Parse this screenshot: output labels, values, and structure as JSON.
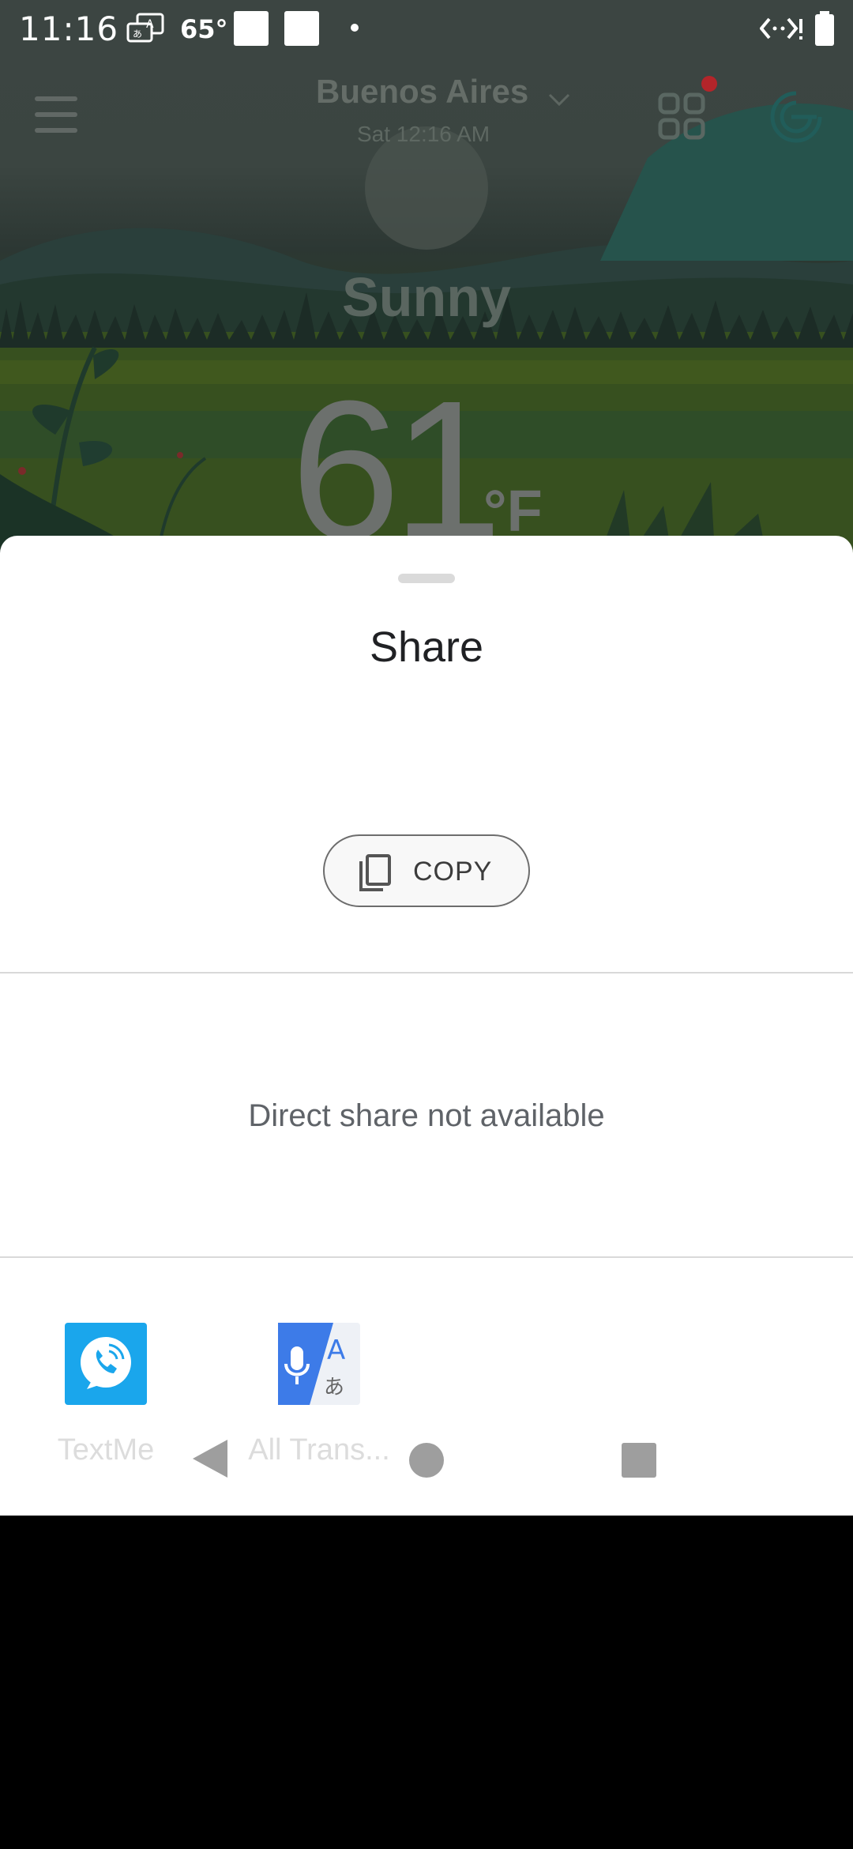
{
  "status_bar": {
    "time": "11:16",
    "temperature": "65°",
    "icons": [
      "translate-notification-icon",
      "blank-notification-icon",
      "blank-notification-icon",
      "more-notifications-dot",
      "data-transfer-icon",
      "battery-icon"
    ]
  },
  "weather_app": {
    "city": "Buenos Aires",
    "local_time": "Sat 12:16 AM",
    "condition": "Sunny",
    "temperature": "61",
    "unit": "°F",
    "icons": [
      "hamburger-menu-icon",
      "grid-apps-icon",
      "notification-dot",
      "brand-logo-icon",
      "chevron-down-icon"
    ]
  },
  "share_sheet": {
    "title": "Share",
    "copy_label": "COPY",
    "direct_share_message": "Direct share not available",
    "apps": [
      {
        "label": "TextMe",
        "icon": "textme-app-icon",
        "color": "#1aa6ec"
      },
      {
        "label": "All Trans...",
        "icon": "all-translator-app-icon",
        "color": "#3d7be8"
      }
    ]
  },
  "nav_bar": {
    "icons": [
      "back-icon",
      "home-icon",
      "recents-icon"
    ]
  },
  "colors": {
    "sheet_background": "#ffffff",
    "scrim": "#3b4540",
    "copy_border": "#6d6d6d",
    "divider": "#d9d9d9",
    "notification_red": "#b3252a"
  }
}
